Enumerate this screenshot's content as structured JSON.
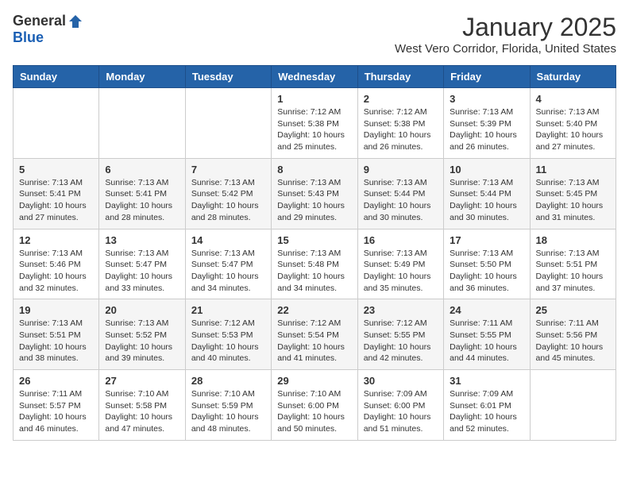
{
  "header": {
    "logo_general": "General",
    "logo_blue": "Blue",
    "month_title": "January 2025",
    "location": "West Vero Corridor, Florida, United States"
  },
  "weekdays": [
    "Sunday",
    "Monday",
    "Tuesday",
    "Wednesday",
    "Thursday",
    "Friday",
    "Saturday"
  ],
  "weeks": [
    [
      {
        "day": "",
        "info": ""
      },
      {
        "day": "",
        "info": ""
      },
      {
        "day": "",
        "info": ""
      },
      {
        "day": "1",
        "info": "Sunrise: 7:12 AM\nSunset: 5:38 PM\nDaylight: 10 hours\nand 25 minutes."
      },
      {
        "day": "2",
        "info": "Sunrise: 7:12 AM\nSunset: 5:38 PM\nDaylight: 10 hours\nand 26 minutes."
      },
      {
        "day": "3",
        "info": "Sunrise: 7:13 AM\nSunset: 5:39 PM\nDaylight: 10 hours\nand 26 minutes."
      },
      {
        "day": "4",
        "info": "Sunrise: 7:13 AM\nSunset: 5:40 PM\nDaylight: 10 hours\nand 27 minutes."
      }
    ],
    [
      {
        "day": "5",
        "info": "Sunrise: 7:13 AM\nSunset: 5:41 PM\nDaylight: 10 hours\nand 27 minutes."
      },
      {
        "day": "6",
        "info": "Sunrise: 7:13 AM\nSunset: 5:41 PM\nDaylight: 10 hours\nand 28 minutes."
      },
      {
        "day": "7",
        "info": "Sunrise: 7:13 AM\nSunset: 5:42 PM\nDaylight: 10 hours\nand 28 minutes."
      },
      {
        "day": "8",
        "info": "Sunrise: 7:13 AM\nSunset: 5:43 PM\nDaylight: 10 hours\nand 29 minutes."
      },
      {
        "day": "9",
        "info": "Sunrise: 7:13 AM\nSunset: 5:44 PM\nDaylight: 10 hours\nand 30 minutes."
      },
      {
        "day": "10",
        "info": "Sunrise: 7:13 AM\nSunset: 5:44 PM\nDaylight: 10 hours\nand 30 minutes."
      },
      {
        "day": "11",
        "info": "Sunrise: 7:13 AM\nSunset: 5:45 PM\nDaylight: 10 hours\nand 31 minutes."
      }
    ],
    [
      {
        "day": "12",
        "info": "Sunrise: 7:13 AM\nSunset: 5:46 PM\nDaylight: 10 hours\nand 32 minutes."
      },
      {
        "day": "13",
        "info": "Sunrise: 7:13 AM\nSunset: 5:47 PM\nDaylight: 10 hours\nand 33 minutes."
      },
      {
        "day": "14",
        "info": "Sunrise: 7:13 AM\nSunset: 5:47 PM\nDaylight: 10 hours\nand 34 minutes."
      },
      {
        "day": "15",
        "info": "Sunrise: 7:13 AM\nSunset: 5:48 PM\nDaylight: 10 hours\nand 34 minutes."
      },
      {
        "day": "16",
        "info": "Sunrise: 7:13 AM\nSunset: 5:49 PM\nDaylight: 10 hours\nand 35 minutes."
      },
      {
        "day": "17",
        "info": "Sunrise: 7:13 AM\nSunset: 5:50 PM\nDaylight: 10 hours\nand 36 minutes."
      },
      {
        "day": "18",
        "info": "Sunrise: 7:13 AM\nSunset: 5:51 PM\nDaylight: 10 hours\nand 37 minutes."
      }
    ],
    [
      {
        "day": "19",
        "info": "Sunrise: 7:13 AM\nSunset: 5:51 PM\nDaylight: 10 hours\nand 38 minutes."
      },
      {
        "day": "20",
        "info": "Sunrise: 7:13 AM\nSunset: 5:52 PM\nDaylight: 10 hours\nand 39 minutes."
      },
      {
        "day": "21",
        "info": "Sunrise: 7:12 AM\nSunset: 5:53 PM\nDaylight: 10 hours\nand 40 minutes."
      },
      {
        "day": "22",
        "info": "Sunrise: 7:12 AM\nSunset: 5:54 PM\nDaylight: 10 hours\nand 41 minutes."
      },
      {
        "day": "23",
        "info": "Sunrise: 7:12 AM\nSunset: 5:55 PM\nDaylight: 10 hours\nand 42 minutes."
      },
      {
        "day": "24",
        "info": "Sunrise: 7:11 AM\nSunset: 5:55 PM\nDaylight: 10 hours\nand 44 minutes."
      },
      {
        "day": "25",
        "info": "Sunrise: 7:11 AM\nSunset: 5:56 PM\nDaylight: 10 hours\nand 45 minutes."
      }
    ],
    [
      {
        "day": "26",
        "info": "Sunrise: 7:11 AM\nSunset: 5:57 PM\nDaylight: 10 hours\nand 46 minutes."
      },
      {
        "day": "27",
        "info": "Sunrise: 7:10 AM\nSunset: 5:58 PM\nDaylight: 10 hours\nand 47 minutes."
      },
      {
        "day": "28",
        "info": "Sunrise: 7:10 AM\nSunset: 5:59 PM\nDaylight: 10 hours\nand 48 minutes."
      },
      {
        "day": "29",
        "info": "Sunrise: 7:10 AM\nSunset: 6:00 PM\nDaylight: 10 hours\nand 50 minutes."
      },
      {
        "day": "30",
        "info": "Sunrise: 7:09 AM\nSunset: 6:00 PM\nDaylight: 10 hours\nand 51 minutes."
      },
      {
        "day": "31",
        "info": "Sunrise: 7:09 AM\nSunset: 6:01 PM\nDaylight: 10 hours\nand 52 minutes."
      },
      {
        "day": "",
        "info": ""
      }
    ]
  ]
}
